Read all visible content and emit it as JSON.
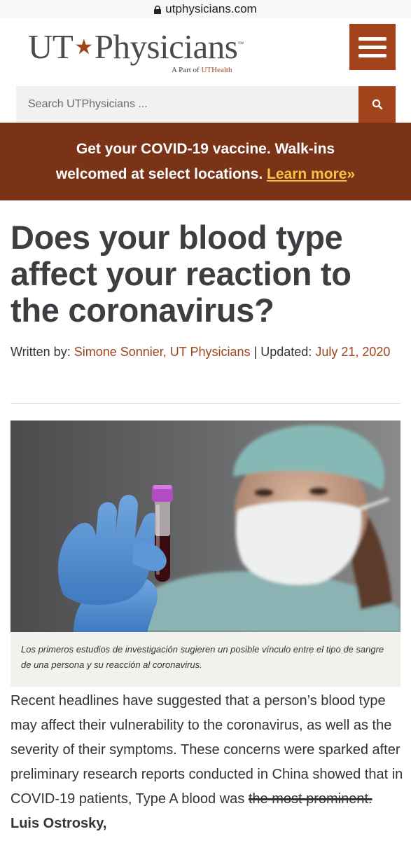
{
  "browser": {
    "url": "utphysicians.com"
  },
  "header": {
    "logo_left": "UT",
    "logo_right": "Physicians",
    "logo_tm": "™",
    "logo_sub_prefix": "A Part of",
    "logo_sub_brand": "UTHealth"
  },
  "search": {
    "placeholder": "Search UTPhysicians ..."
  },
  "banner": {
    "line1": "Get your COVID-19 vaccine. Walk-ins",
    "line2": "welcomed at select locations.",
    "link": "Learn more",
    "link_arrows": "»"
  },
  "article": {
    "title": "Does your blood type affect your reaction to the coronavirus?",
    "written_by_label": "Written by:",
    "author": "Simone Sonnier, UT Physicians",
    "separator": "|",
    "updated_label": "Updated:",
    "date": "July 21, 2020",
    "caption": "Los primeros estudios de investigación sugieren un posible vínculo entre el tipo de sangre de una persona y su reacción al coronavirus.",
    "body_main": "Recent headlines have suggested that a person’s blood type may affect their vulnerability to the coronavirus, as well as the severity of their symptoms. These concerns were sparked after preliminary research reports conducted in China showed that in COVID-19 patients, Type A blood was",
    "body_struck": "the most prominent.",
    "body_bold": "Luis Ostrosky,"
  },
  "colors": {
    "brand": "#a3431b",
    "banner": "#7b3317",
    "link_yellow": "#f5c243"
  }
}
